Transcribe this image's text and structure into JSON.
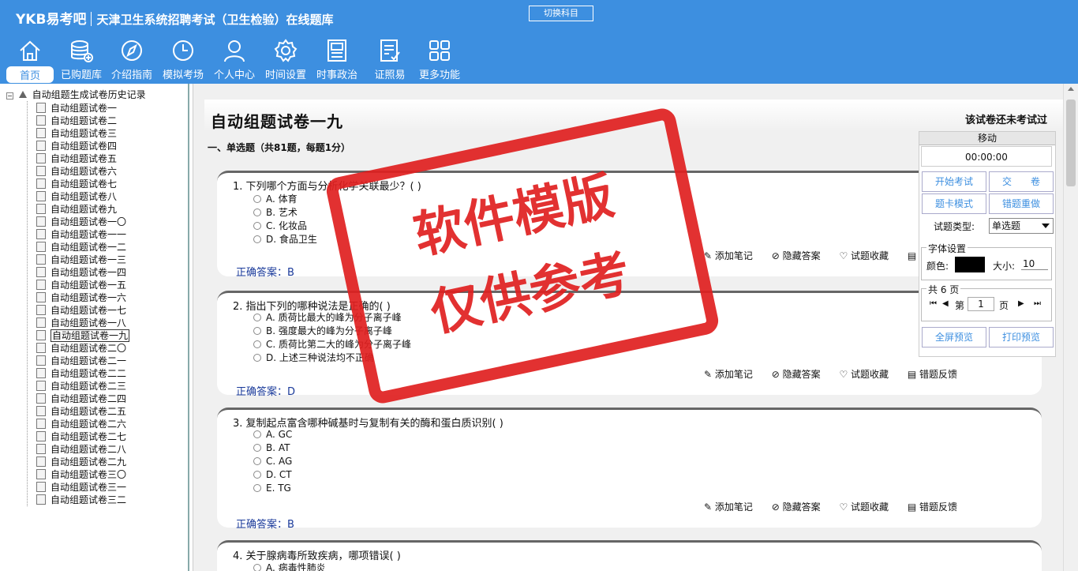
{
  "header": {
    "brand_logo": "YKB易考吧",
    "title": "天津卫生系统招聘考试（卫生检验）在线题库",
    "switch_label": "切换科目"
  },
  "nav": [
    {
      "label": "首页",
      "icon": "home-icon"
    },
    {
      "label": "已购题库",
      "icon": "database-icon"
    },
    {
      "label": "介绍指南",
      "icon": "compass-icon"
    },
    {
      "label": "模拟考场",
      "icon": "clock-icon"
    },
    {
      "label": "个人中心",
      "icon": "user-icon"
    },
    {
      "label": "时间设置",
      "icon": "gear-icon"
    },
    {
      "label": "时事政治",
      "icon": "news-icon"
    },
    {
      "label": "证照易",
      "icon": "checklist-icon"
    },
    {
      "label": "更多功能",
      "icon": "grid-icon"
    }
  ],
  "tree": {
    "root": "自动组题生成试卷历史记录",
    "items": [
      "自动组题试卷一",
      "自动组题试卷二",
      "自动组题试卷三",
      "自动组题试卷四",
      "自动组题试卷五",
      "自动组题试卷六",
      "自动组题试卷七",
      "自动组题试卷八",
      "自动组题试卷九",
      "自动组题试卷一〇",
      "自动组题试卷一一",
      "自动组题试卷一二",
      "自动组题试卷一三",
      "自动组题试卷一四",
      "自动组题试卷一五",
      "自动组题试卷一六",
      "自动组题试卷一七",
      "自动组题试卷一八",
      "自动组题试卷一九",
      "自动组题试卷二〇",
      "自动组题试卷二一",
      "自动组题试卷二二",
      "自动组题试卷二三",
      "自动组题试卷二四",
      "自动组题试卷二五",
      "自动组题试卷二六",
      "自动组题试卷二七",
      "自动组题试卷二八",
      "自动组题试卷二九",
      "自动组题试卷三〇",
      "自动组题试卷三一",
      "自动组题试卷三二"
    ],
    "selected": "自动组题试卷一九"
  },
  "paper": {
    "title": "自动组题试卷一九",
    "status": "该试卷还未考试过",
    "section": "一、单选题（共81题，每题1分）"
  },
  "actions": {
    "note": "添加笔记",
    "hide": "隐藏答案",
    "fav": "试题收藏",
    "feedback": "错题反馈"
  },
  "questions": [
    {
      "text": "1. 下列哪个方面与分析化学关联最少？( )",
      "options": [
        "A. 体育",
        "B. 艺术",
        "C. 化妆品",
        "D. 食品卫生"
      ],
      "answer": "正确答案：B"
    },
    {
      "text": "2. 指出下列的哪种说法是正确的( )",
      "options": [
        "A. 质荷比最大的峰为分子离子峰",
        "B. 强度最大的峰为分子离子峰",
        "C. 质荷比第二大的峰为分子离子峰",
        "D. 上述三种说法均不正确"
      ],
      "answer": "正确答案：D"
    },
    {
      "text": "3. 复制起点富含哪种碱基时与复制有关的酶和蛋白质识别( )",
      "options": [
        "A. GC",
        "B. AT",
        "C. AG",
        "D. CT",
        "E. TG"
      ],
      "answer": "正确答案：B"
    },
    {
      "text": "4. 关于腺病毒所致疾病，哪项错误( )",
      "options": [
        "A. 病毒性肺炎"
      ],
      "answer": ""
    }
  ],
  "side": {
    "move": "移动",
    "timer": "00:00:00",
    "start": "开始考试",
    "submit": "交　　卷",
    "card": "题卡模式",
    "redo": "错题重做",
    "type_label": "试题类型:",
    "type_value": "单选题",
    "font_legend": "字体设置",
    "color_label": "颜色:",
    "color_value": "#000000",
    "size_label": "大小:",
    "size_value": "10",
    "pages_legend": "共 6 页",
    "page_prefix": "第",
    "page_value": "1",
    "page_suffix": "页",
    "fullscreen": "全屏预览",
    "print": "打印预览"
  },
  "watermark": {
    "line1": "软件模版",
    "line2": "仅供参考"
  }
}
